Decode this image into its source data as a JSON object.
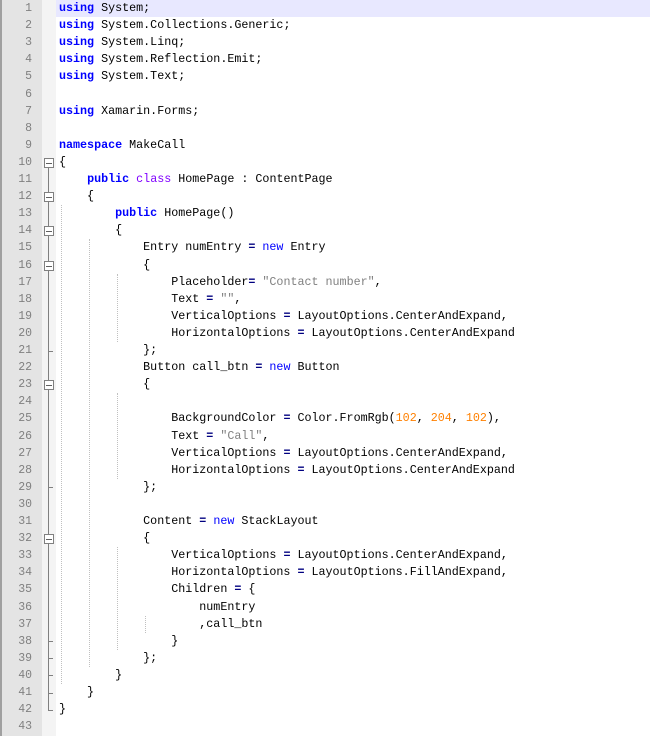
{
  "editor": {
    "current_line": 1,
    "fold_open_lines": [
      10,
      12,
      14,
      16,
      23,
      32
    ],
    "fold_end_lines": [
      21,
      29,
      38,
      39,
      40,
      41,
      42
    ],
    "lines": [
      [
        [
          "using",
          "kw"
        ],
        [
          " System;",
          ""
        ]
      ],
      [
        [
          "using",
          "kw"
        ],
        [
          " System.Collections.Generic;",
          ""
        ]
      ],
      [
        [
          "using",
          "kw"
        ],
        [
          " System.Linq;",
          ""
        ]
      ],
      [
        [
          "using",
          "kw"
        ],
        [
          " System.Reflection.Emit;",
          ""
        ]
      ],
      [
        [
          "using",
          "kw"
        ],
        [
          " System.Text;",
          ""
        ]
      ],
      [],
      [
        [
          "using",
          "kw"
        ],
        [
          " Xamarin.Forms;",
          ""
        ]
      ],
      [],
      [
        [
          "namespace",
          "kw"
        ],
        [
          " MakeCall",
          ""
        ]
      ],
      [
        [
          "{",
          ""
        ]
      ],
      [
        [
          "    ",
          ""
        ],
        [
          "public",
          "kw"
        ],
        [
          " ",
          ""
        ],
        [
          "class",
          "kw2"
        ],
        [
          " HomePage : ContentPage",
          ""
        ]
      ],
      [
        [
          "    {",
          ""
        ]
      ],
      [
        [
          "        ",
          ""
        ],
        [
          "public",
          "kw"
        ],
        [
          " HomePage()",
          ""
        ]
      ],
      [
        [
          "        {",
          ""
        ]
      ],
      [
        [
          "            Entry numEntry ",
          ""
        ],
        [
          "=",
          "op"
        ],
        [
          " ",
          ""
        ],
        [
          "new",
          "nw"
        ],
        [
          " Entry",
          ""
        ]
      ],
      [
        [
          "            {",
          ""
        ]
      ],
      [
        [
          "                Placeholder",
          ""
        ],
        [
          "=",
          "op"
        ],
        [
          " ",
          ""
        ],
        [
          "\"Contact number\"",
          "str"
        ],
        [
          ",",
          ""
        ]
      ],
      [
        [
          "                Text ",
          ""
        ],
        [
          "=",
          "op"
        ],
        [
          " ",
          ""
        ],
        [
          "\"\"",
          "str"
        ],
        [
          ",",
          ""
        ]
      ],
      [
        [
          "                VerticalOptions ",
          ""
        ],
        [
          "=",
          "op"
        ],
        [
          " LayoutOptions.CenterAndExpand,",
          ""
        ]
      ],
      [
        [
          "                HorizontalOptions ",
          ""
        ],
        [
          "=",
          "op"
        ],
        [
          " LayoutOptions.CenterAndExpand",
          ""
        ]
      ],
      [
        [
          "            };",
          ""
        ]
      ],
      [
        [
          "            Button call_btn ",
          ""
        ],
        [
          "=",
          "op"
        ],
        [
          " ",
          ""
        ],
        [
          "new",
          "nw"
        ],
        [
          " Button",
          ""
        ]
      ],
      [
        [
          "            {",
          ""
        ]
      ],
      [],
      [
        [
          "                BackgroundColor ",
          ""
        ],
        [
          "=",
          "op"
        ],
        [
          " Color.FromRgb(",
          ""
        ],
        [
          "102",
          "num"
        ],
        [
          ", ",
          ""
        ],
        [
          "204",
          "num"
        ],
        [
          ", ",
          ""
        ],
        [
          "102",
          "num"
        ],
        [
          "),",
          ""
        ]
      ],
      [
        [
          "                Text ",
          ""
        ],
        [
          "=",
          "op"
        ],
        [
          " ",
          ""
        ],
        [
          "\"Call\"",
          "str"
        ],
        [
          ",",
          ""
        ]
      ],
      [
        [
          "                VerticalOptions ",
          ""
        ],
        [
          "=",
          "op"
        ],
        [
          " LayoutOptions.CenterAndExpand,",
          ""
        ]
      ],
      [
        [
          "                HorizontalOptions ",
          ""
        ],
        [
          "=",
          "op"
        ],
        [
          " LayoutOptions.CenterAndExpand",
          ""
        ]
      ],
      [
        [
          "            };",
          ""
        ]
      ],
      [],
      [
        [
          "            Content ",
          ""
        ],
        [
          "=",
          "op"
        ],
        [
          " ",
          ""
        ],
        [
          "new",
          "nw"
        ],
        [
          " StackLayout",
          ""
        ]
      ],
      [
        [
          "            {",
          ""
        ]
      ],
      [
        [
          "                VerticalOptions ",
          ""
        ],
        [
          "=",
          "op"
        ],
        [
          " LayoutOptions.CenterAndExpand,",
          ""
        ]
      ],
      [
        [
          "                HorizontalOptions ",
          ""
        ],
        [
          "=",
          "op"
        ],
        [
          " LayoutOptions.FillAndExpand,",
          ""
        ]
      ],
      [
        [
          "                Children ",
          ""
        ],
        [
          "=",
          "op"
        ],
        [
          " {",
          ""
        ]
      ],
      [
        [
          "                    numEntry",
          ""
        ]
      ],
      [
        [
          "                    ,call_btn",
          ""
        ]
      ],
      [
        [
          "                }",
          ""
        ]
      ],
      [
        [
          "            };",
          ""
        ]
      ],
      [
        [
          "        }",
          ""
        ]
      ],
      [
        [
          "    }",
          ""
        ]
      ],
      [
        [
          "}",
          ""
        ]
      ],
      []
    ]
  }
}
